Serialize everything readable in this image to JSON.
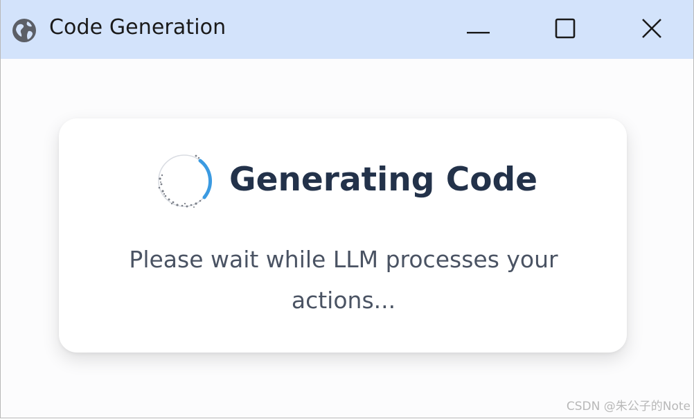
{
  "window": {
    "title": "Code Generation",
    "title_bar_color": "#d3e3fb",
    "app_icon": "globe-icon",
    "controls": {
      "minimize_icon": "minimize-icon",
      "maximize_icon": "maximize-icon",
      "close_icon": "close-icon"
    }
  },
  "dialog": {
    "spinner_icon": "loading-spinner-icon",
    "heading": "Generating Code",
    "message": "Please wait while LLM processes your actions...",
    "accent_color": "#3b9ae1",
    "heading_color": "#23324a"
  },
  "watermark": {
    "text": "CSDN @朱公子的Note"
  }
}
